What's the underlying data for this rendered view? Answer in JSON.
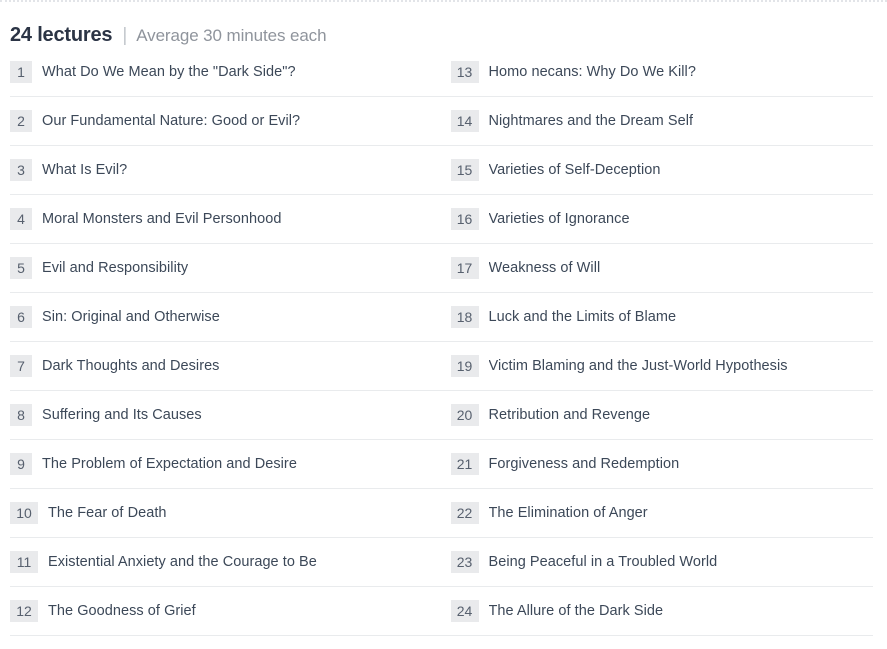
{
  "header": {
    "count_label": "24 lectures",
    "divider": "|",
    "subtitle": "Average 30 minutes each"
  },
  "colors": {
    "title_text": "#3c4858",
    "count_text": "#2b3445",
    "subtitle_text": "#8f949c",
    "badge_background": "#e9eaec",
    "badge_text": "#57606e",
    "row_separator": "#e9ebed",
    "top_dotted_border": "#e2e4e8",
    "page_background": "#ffffff"
  },
  "lectures": [
    {
      "number": "1",
      "title": "What Do We Mean by the \"Dark Side\"?"
    },
    {
      "number": "2",
      "title": "Our Fundamental Nature: Good or Evil?"
    },
    {
      "number": "3",
      "title": "What Is Evil?"
    },
    {
      "number": "4",
      "title": "Moral Monsters and Evil Personhood"
    },
    {
      "number": "5",
      "title": "Evil and Responsibility"
    },
    {
      "number": "6",
      "title": "Sin: Original and Otherwise"
    },
    {
      "number": "7",
      "title": "Dark Thoughts and Desires"
    },
    {
      "number": "8",
      "title": "Suffering and Its Causes"
    },
    {
      "number": "9",
      "title": "The Problem of Expectation and Desire"
    },
    {
      "number": "10",
      "title": "The Fear of Death"
    },
    {
      "number": "11",
      "title": "Existential Anxiety and the Courage to Be"
    },
    {
      "number": "12",
      "title": "The Goodness of Grief"
    },
    {
      "number": "13",
      "title": "Homo necans: Why Do We Kill?"
    },
    {
      "number": "14",
      "title": "Nightmares and the Dream Self"
    },
    {
      "number": "15",
      "title": "Varieties of Self-Deception"
    },
    {
      "number": "16",
      "title": "Varieties of Ignorance"
    },
    {
      "number": "17",
      "title": "Weakness of Will"
    },
    {
      "number": "18",
      "title": "Luck and the Limits of Blame"
    },
    {
      "number": "19",
      "title": "Victim Blaming and the Just-World Hypothesis"
    },
    {
      "number": "20",
      "title": "Retribution and Revenge"
    },
    {
      "number": "21",
      "title": "Forgiveness and Redemption"
    },
    {
      "number": "22",
      "title": "The Elimination of Anger"
    },
    {
      "number": "23",
      "title": "Being Peaceful in a Troubled World"
    },
    {
      "number": "24",
      "title": "The Allure of the Dark Side"
    }
  ]
}
